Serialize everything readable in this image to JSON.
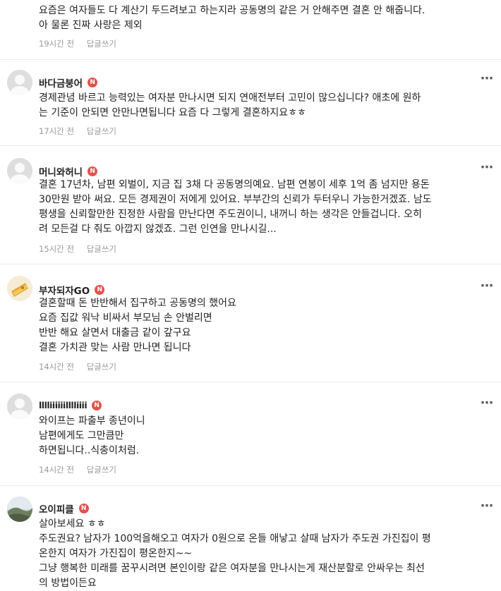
{
  "comments": [
    {
      "nickname": "",
      "badge": "",
      "lines": [
        "요즘은 여자들도 다 계산기 두드려보고 하는지라 공동명의 같은 거 안해주면 결혼 안 해줍니다.",
        "아 물론 진짜 사랑은 제외"
      ],
      "time": "19시간 전",
      "reply_label": "답글쓰기"
    },
    {
      "nickname": "바다금붕어",
      "badge": "N",
      "lines": [
        "경제관념 바르고 능력있는 여자분 만나시면 되지 연애전부터 고민이 많으십니다? 애초에 원하",
        "는 기준이 안되면 안만나면됩니다 요즘 다 그렇게 결혼하지요ㅎㅎ"
      ],
      "time": "17시간 전",
      "reply_label": "답글쓰기"
    },
    {
      "nickname": "머니와허니",
      "badge": "N",
      "lines": [
        "결혼 17년차, 남편 외벌이, 지금 집 3채 다 공동명의예요. 남편 연봉이 세후 1억 좀 넘지만 용돈",
        "30만원 받아 써요. 모든 경제권이 저에게 있어요. 부부간의 신뢰가 두터우니 가능한거겠죠. 남도",
        "평생을 신뢰할만한 진정한 사람을 만난다면 주도권이니, 내꺼니 하는 생각은 안들겁니다. 오히",
        "려 모든걸 다 줘도 아깝지 않겠죠. 그런 인연을 만나시길..."
      ],
      "time": "15시간 전",
      "reply_label": "답글쓰기"
    },
    {
      "nickname": "부자되자GO",
      "badge": "N",
      "lines": [
        "결혼할때 돈 반반해서 집구하고 공동명의 했어요",
        "요즘 집값 워낙 비싸서 부모님 손 안벌리면",
        "반반 해요 살면서 대출금 같이 갚구요",
        "결혼 가치관 맞는 사람 만나면 됩니다"
      ],
      "time": "14시간 전",
      "reply_label": "답글쓰기"
    },
    {
      "nickname": "lllliiiiiilllliiii",
      "badge": "N",
      "lines": [
        "와이프는 파출부 종년이니",
        "남편에게도 그만큼만",
        "하면됩니다..식충이처럼."
      ],
      "time": "14시간 전",
      "reply_label": "답글쓰기"
    },
    {
      "nickname": "오이피클",
      "badge": "N",
      "lines": [
        "살아보세요 ㅎㅎ",
        "주도권요? 남자가 100억을해오고 여자가 0원으로 온들 애낳고 살때 남자가 주도권 가진집이 평",
        "온한지 여자가 가진집이 평온한지~~",
        "그냥 행복한 미래를 꿈꾸시려면 본인이랑 같은 여자분을 만나시는게 재산분할로 안싸우는 최선",
        "의 방법이든요"
      ],
      "time": "",
      "reply_label": ""
    }
  ],
  "more_icon": "more-vertical-icon"
}
